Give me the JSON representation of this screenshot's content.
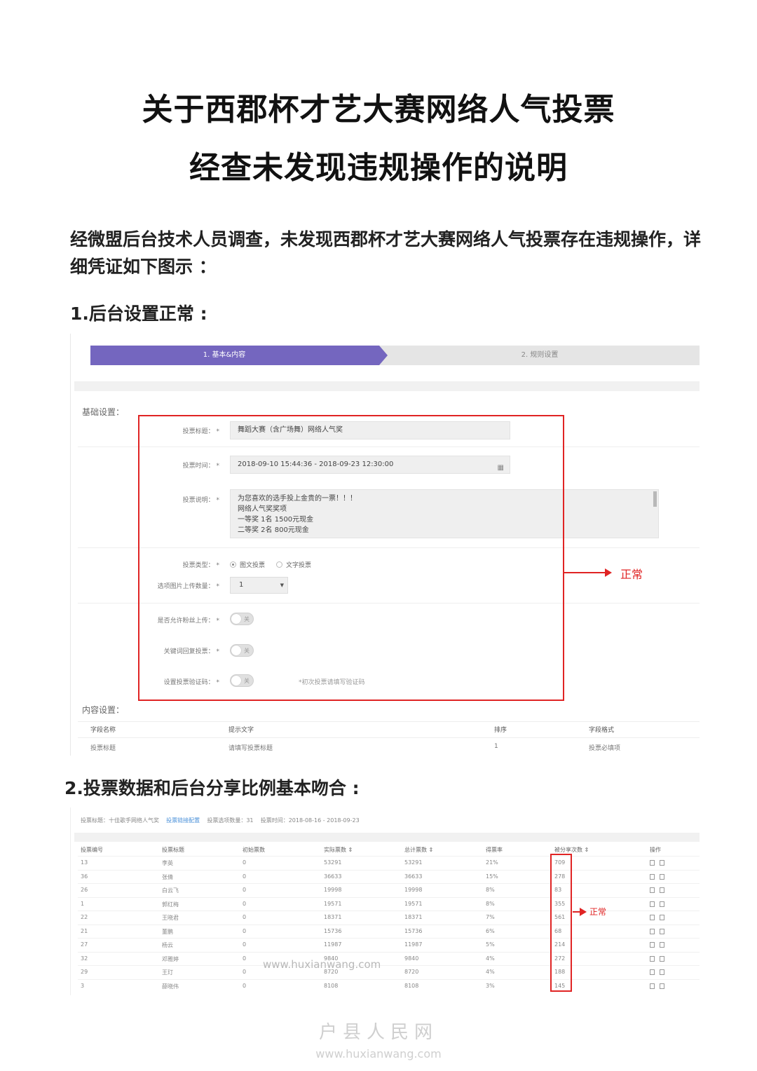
{
  "doc": {
    "title_line1": "关于西郡杯才艺大赛网络人气投票",
    "title_line2": "经查未发现违规操作的说明",
    "intro": "经微盟后台技术人员调查，未发现西郡杯才艺大赛网络人气投票存在违规操作，详细凭证如下图示 ：",
    "heading1": "1.后台设置正常 :",
    "heading2": "2.投票数据和后台分享比例基本吻合 :"
  },
  "settings": {
    "step1": "1. 基本&内容",
    "step2": "2. 规则设置",
    "basic_section": "基础设置：",
    "vote_title_label": "投票标题： *",
    "vote_title_value": "舞蹈大赛（含广场舞）网络人气奖",
    "vote_time_label": "投票时间： *",
    "vote_time_value": "2018-09-10 15:44:36 - 2018-09-23 12:30:00",
    "calendar_icon": "calendar-icon",
    "desc_label": "投票说明： *",
    "desc_lines": [
      "为您喜欢的选手投上金贵的一票！！！",
      "网络人气奖奖项",
      "一等奖    1名     1500元现金",
      "二等奖    2名     800元现金"
    ],
    "vote_type_label": "投票类型： *",
    "vote_type_option1": "图文投票",
    "vote_type_option2": "文字投票",
    "upload_count_label": "选项图片上传数量： *",
    "upload_count_value": "1",
    "allow_fans_label": "是否允许粉丝上传： *",
    "keyword_reply_label": "关键词回复投票： *",
    "captcha_label": "设置投票验证码： *",
    "toggle_off": "关",
    "captcha_hint": "*初次投票请填写验证码",
    "content_section": "内容设置：",
    "table_headers": [
      "字段名称",
      "提示文字",
      "排序",
      "字段格式"
    ],
    "table_row": [
      "投票标题",
      "请填写投票标题",
      "1",
      "投票必填项"
    ],
    "annotation": "正常"
  },
  "stats": {
    "top_title": "投票标题：十佳歌手网络人气奖",
    "top_link": "投票链接配置",
    "top_count": "投票选项数量：31",
    "top_time": "投票时间：2018-08-16 - 2018-09-23",
    "headers": [
      "投票编号",
      "投票标题",
      "初始票数",
      "实际票数 ⇕",
      "总计票数 ⇕",
      "得票率",
      "被分享次数 ⇕",
      "操作"
    ],
    "rows": [
      [
        "13",
        "李英",
        "0",
        "53291",
        "53291",
        "21%",
        "709"
      ],
      [
        "36",
        "张倩",
        "0",
        "36633",
        "36633",
        "15%",
        "278"
      ],
      [
        "26",
        "白云飞",
        "0",
        "19998",
        "19998",
        "8%",
        "83"
      ],
      [
        "1",
        "郭红梅",
        "0",
        "19571",
        "19571",
        "8%",
        "355"
      ],
      [
        "22",
        "王晓君",
        "0",
        "18371",
        "18371",
        "7%",
        "561"
      ],
      [
        "21",
        "董鹏",
        "0",
        "15736",
        "15736",
        "6%",
        "68"
      ],
      [
        "27",
        "杨云",
        "0",
        "11987",
        "11987",
        "5%",
        "214"
      ],
      [
        "32",
        "邓雅婷",
        "0",
        "9840",
        "9840",
        "4%",
        "272"
      ],
      [
        "29",
        "王玎",
        "0",
        "8720",
        "8720",
        "4%",
        "188"
      ],
      [
        "3",
        "薛晓伟",
        "0",
        "8108",
        "8108",
        "3%",
        "145"
      ]
    ],
    "annotation": "正常"
  },
  "watermark": {
    "url_mid": "www.huxianwang.com",
    "site_cn": "户县人民网",
    "url_bottom": "www.huxianwang.com"
  },
  "colors": {
    "accent": "#7466bf",
    "annotation_red": "#e02424"
  }
}
